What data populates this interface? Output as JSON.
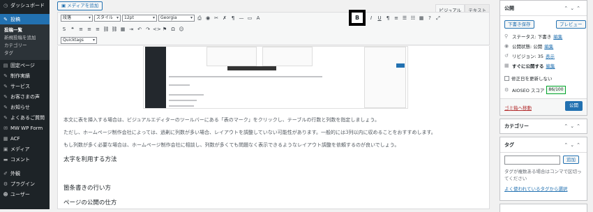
{
  "sidebar": {
    "items": [
      {
        "label": "ダッシュボード",
        "icon": "dashboard-icon",
        "glyph": "◷"
      },
      {
        "label": "投稿",
        "icon": "pin-icon",
        "glyph": "✎",
        "current": true
      },
      {
        "label": "固定ページ",
        "icon": "pages-icon",
        "glyph": "▤"
      },
      {
        "label": "制作実績",
        "icon": "pin-icon",
        "glyph": "✎"
      },
      {
        "label": "サービス",
        "icon": "pin-icon",
        "glyph": "✎"
      },
      {
        "label": "お客さまの声",
        "icon": "pin-icon",
        "glyph": "✎"
      },
      {
        "label": "お知らせ",
        "icon": "pin-icon",
        "glyph": "✎"
      },
      {
        "label": "よくあるご質問",
        "icon": "pin-icon",
        "glyph": "✎"
      },
      {
        "label": "MW WP Form",
        "icon": "form-icon",
        "glyph": "✉"
      },
      {
        "label": "ACF",
        "icon": "acf-icon",
        "glyph": "▦"
      },
      {
        "label": "メディア",
        "icon": "media-icon",
        "glyph": "▣"
      },
      {
        "label": "コメント",
        "icon": "comment-icon",
        "glyph": "▬"
      },
      {
        "label": "外観",
        "icon": "appearance-icon",
        "glyph": "✐"
      },
      {
        "label": "プラグイン",
        "icon": "plugin-icon",
        "glyph": "⚙"
      },
      {
        "label": "ユーザー",
        "icon": "user-icon",
        "glyph": "☻"
      }
    ],
    "submenu": [
      "投稿一覧",
      "新規投稿を追加",
      "カテゴリー",
      "タグ"
    ]
  },
  "editor": {
    "add_media": "メディアを追加",
    "tab_visual": "ビジュアル",
    "tab_text": "テキスト",
    "format_select": "段落",
    "style_select": "スタイル",
    "size_select": "12pt",
    "font_select": "Georgia",
    "quicktags_select": "Quicktags",
    "highlight_glyph": "B",
    "paragraphs": [
      "本文に表を挿入する場合は、ビジュアルエディターのツールバーにある「表のマーク」をクリックし、テーブルの行数と列数を指定しましょう。",
      "ただし、ホームページ制作会社によっては、過剰に列数が多い場合、レイアウトを調整していない可能性があります。一般的には3列以内に収めることをおすすめします。",
      "もし列数が多く必要な場合は、ホームページ制作会社に相談し、列数が多くても問題なく表示できるようなレイアウト調整を依頼するのが良いでしょう。"
    ],
    "headings": [
      "太字を利用する方法",
      "箇条書きの行い方",
      "ページの公開の仕方"
    ]
  },
  "publish": {
    "title": "公開",
    "save_draft": "下書き保存",
    "preview": "プレビュー",
    "status": "ステータス: 下書き",
    "visibility": "公開状態: 公開",
    "revisions": "リビジョン: 35",
    "revisions_link": "表示",
    "schedule": "すぐに公開する",
    "edit": "編集",
    "modified_label": "修正日を更新しない",
    "aioseo": "AIOSEO スコア",
    "score": "86/100",
    "trash": "ゴミ箱へ移動",
    "publish_btn": "公開"
  },
  "category": {
    "title": "カテゴリー"
  },
  "tags": {
    "title": "タグ",
    "add": "追加",
    "help": "タグが複数ある場合はコンマで区切ってください",
    "popular": "よく使われているタグから選択"
  }
}
